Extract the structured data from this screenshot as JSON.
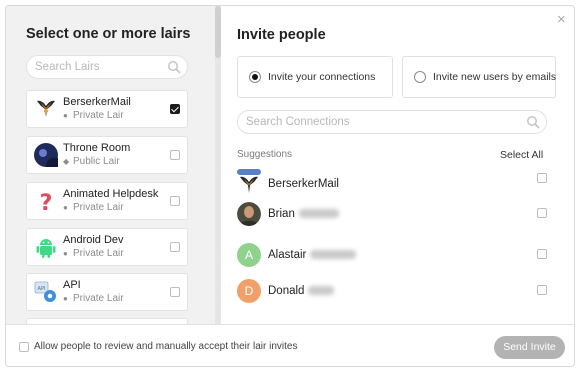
{
  "left": {
    "title": "Select one or more lairs",
    "search_placeholder": "Search Lairs",
    "lairs": [
      {
        "name": "BerserkerMail",
        "privacy": "Private Lair",
        "checked": true
      },
      {
        "name": "Throne Room",
        "privacy": "Public Lair",
        "checked": false
      },
      {
        "name": "Animated Helpdesk",
        "privacy": "Private Lair",
        "checked": false
      },
      {
        "name": "Android Dev",
        "privacy": "Private Lair",
        "checked": false
      },
      {
        "name": "API",
        "privacy": "Private Lair",
        "checked": false
      }
    ]
  },
  "right": {
    "title": "Invite people",
    "close_icon": "×",
    "option_connections": "Invite your connections",
    "option_emails": "Invite new users by emails",
    "search_placeholder": "Search Connections",
    "suggestions_label": "Suggestions",
    "select_all": "Select All",
    "people": [
      {
        "first": "BerserkerMail",
        "avatar": "logo"
      },
      {
        "first": "Brian",
        "avatar": "photo"
      },
      {
        "first": "Alastair",
        "avatar": "letter",
        "letter": "A",
        "color": "#8fd28e"
      },
      {
        "first": "Donald",
        "avatar": "letter",
        "letter": "D",
        "color": "#f2a06b"
      }
    ]
  },
  "footer": {
    "allow_review": "Allow people to review and manually accept their lair invites",
    "send_invite": "Send Invite"
  }
}
